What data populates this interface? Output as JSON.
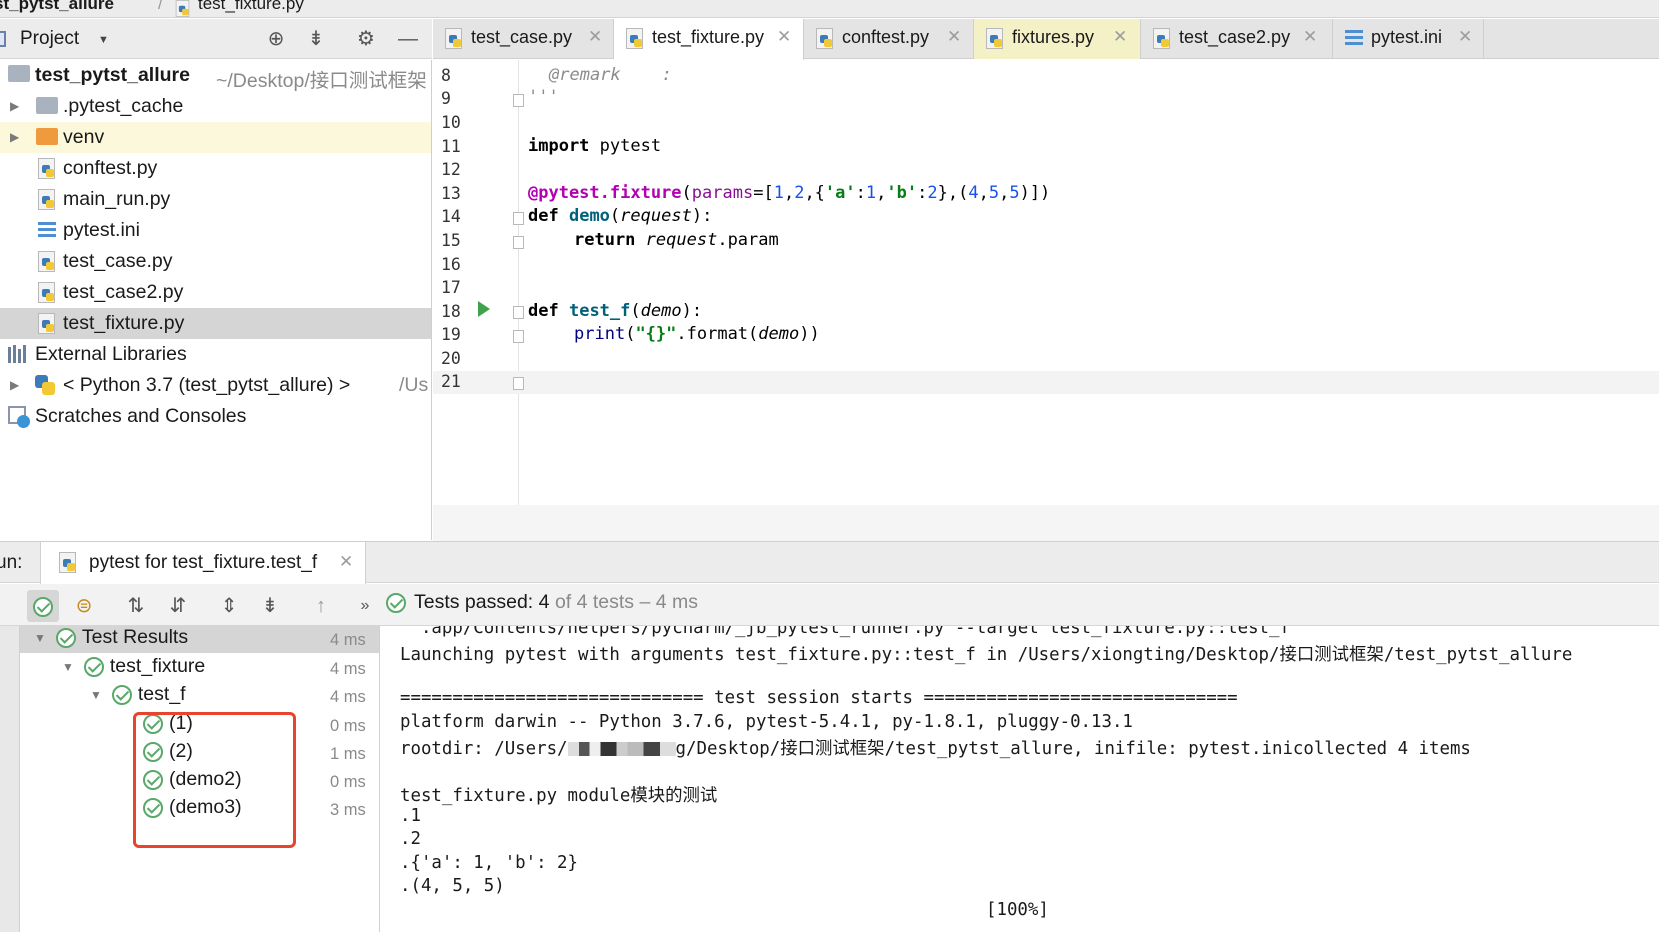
{
  "breadcrumb": {
    "project": "st_pytst_allure",
    "file": "test_fixture.py"
  },
  "project_panel": {
    "title": "Project",
    "icons": [
      "locate-icon",
      "collapse-icon",
      "gear-icon",
      "minimize-icon"
    ],
    "tree": [
      {
        "label": "test_pytst_allure",
        "suffix": "~/Desktop/接口测试框架",
        "type": "root-folder"
      },
      {
        "label": ".pytest_cache",
        "type": "folder"
      },
      {
        "label": "venv",
        "type": "folder-orange"
      },
      {
        "label": "conftest.py",
        "type": "py"
      },
      {
        "label": "main_run.py",
        "type": "py"
      },
      {
        "label": "pytest.ini",
        "type": "ini"
      },
      {
        "label": "test_case.py",
        "type": "py"
      },
      {
        "label": "test_case2.py",
        "type": "py"
      },
      {
        "label": "test_fixture.py",
        "type": "py"
      },
      {
        "label": "External Libraries",
        "type": "libs"
      },
      {
        "label": "< Python 3.7 (test_pytst_allure) >",
        "suffix": "/Us",
        "type": "python"
      },
      {
        "label": "Scratches and Consoles",
        "type": "scratch"
      }
    ]
  },
  "tabs": [
    {
      "label": "test_case.py"
    },
    {
      "label": "test_fixture.py",
      "active": true
    },
    {
      "label": "conftest.py"
    },
    {
      "label": "fixtures.py"
    },
    {
      "label": "test_case2.py"
    },
    {
      "label": "pytest.ini"
    }
  ],
  "editor": {
    "line_numbers": [
      "8",
      "9",
      "10",
      "11",
      "12",
      "13",
      "14",
      "15",
      "16",
      "17",
      "18",
      "19",
      "20",
      "21"
    ],
    "code": {
      "l8": "@remark    :",
      "l9": "'''",
      "l11_kw": "import",
      "l11_rest": " pytest",
      "l13_dec": "@pytest.fixture",
      "l13_p1": "(",
      "l13_param": "params",
      "l13_p2": "=[",
      "l13_n1": "1",
      "l13_c1": ",",
      "l13_n2": "2",
      "l13_c2": ",{",
      "l13_s1": "'a'",
      "l13_c3": ":",
      "l13_n3": "1",
      "l13_c4": ",",
      "l13_s2": "'b'",
      "l13_c5": ":",
      "l13_n4": "2",
      "l13_c6": "},(",
      "l13_n5": "4",
      "l13_c7": ",",
      "l13_n6": "5",
      "l13_c8": ",",
      "l13_n7": "5",
      "l13_end": ")])",
      "l14_kw": "def",
      "l14_fn": "demo",
      "l14_p1": "(",
      "l14_arg": "request",
      "l14_end": "):",
      "l15_kw": "return",
      "l15_arg": "request",
      "l15_end": ".param",
      "l18_kw": "def",
      "l18_fn": "test_f",
      "l18_p1": "(",
      "l18_arg": "demo",
      "l18_end": "):",
      "l19_bi": "print",
      "l19_p1": "(",
      "l19_str": "\"{}\"",
      "l19_mid": ".format(",
      "l19_arg": "demo",
      "l19_end": "))"
    }
  },
  "run_panel": {
    "label": "un:",
    "tab_label": "pytest for test_fixture.test_f",
    "status_prefix": "Tests passed:",
    "status_passed": "4",
    "status_suffix": "of 4 tests – 4 ms",
    "results": [
      {
        "label": "Test Results",
        "time": "4 ms"
      },
      {
        "label": "test_fixture",
        "time": "4 ms"
      },
      {
        "label": "test_f",
        "time": "4 ms"
      },
      {
        "label": "(1)",
        "time": "0 ms"
      },
      {
        "label": "(2)",
        "time": "1 ms"
      },
      {
        "label": "(demo2)",
        "time": "0 ms"
      },
      {
        "label": "(demo3)",
        "time": "3 ms"
      }
    ],
    "console": {
      "l0": "  .app/Contents/helpers/pycharm/_jb_pytest_runner.py --target test_fixture.py::test_f",
      "l1": "Launching pytest with arguments test_fixture.py::test_f in /Users/xiongting/Desktop/接口测试框架/test_pytst_allure",
      "l3": "============================= test session starts ==============================",
      "l4": "platform darwin -- Python 3.7.6, pytest-5.4.1, py-1.8.1, pluggy-0.13.1",
      "l5a": "rootdir: /Users/",
      "l5b": "g/Desktop/接口测试框架/test_pytst_allure, inifile: pytest.inicollected 4 items",
      "l7": "test_fixture.py module模块的测试",
      "l8": ".1",
      "l9": ".2",
      "l10": ".{'a': 1, 'b': 2}",
      "l11": ".(4, 5, 5)",
      "l12": "[100%]"
    }
  }
}
